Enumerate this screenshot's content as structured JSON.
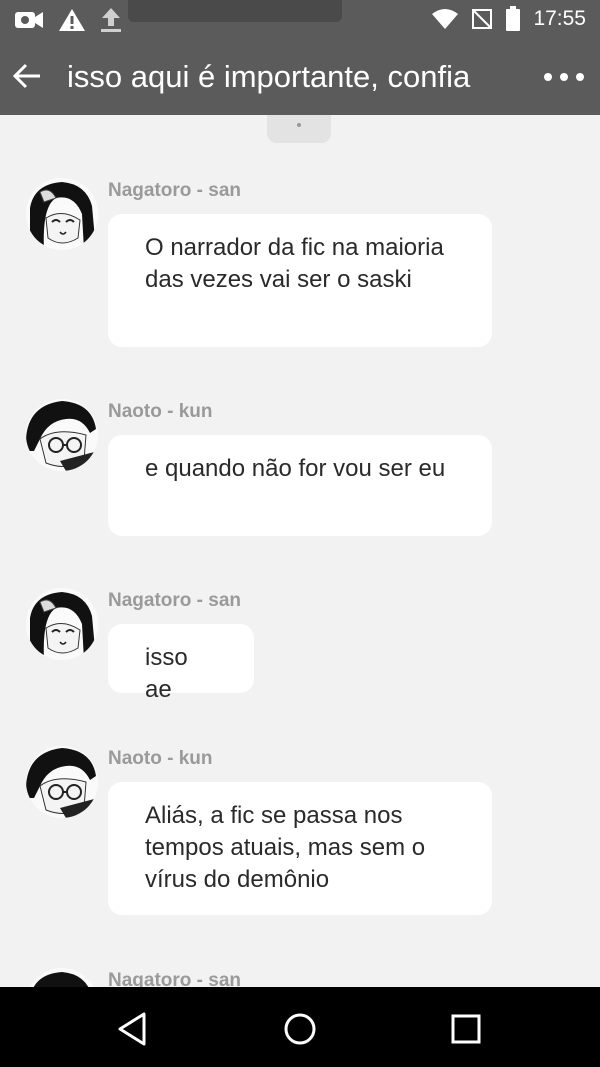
{
  "status_bar": {
    "time": "17:55",
    "left_icons": [
      "video-camera-icon",
      "warning-icon",
      "upload-icon"
    ],
    "right_icons": [
      "wifi-icon",
      "no-sim-icon",
      "battery-icon"
    ]
  },
  "app_bar": {
    "title": "isso aqui é importante, confia",
    "back_icon": "arrow-left-icon",
    "menu_icon": "more-horizontal-icon"
  },
  "messages": [
    {
      "author": "Nagatoro - san",
      "avatar": "avatar-nagatoro",
      "text": "O narrador da fic na maioria das vezes vai ser o saski"
    },
    {
      "author": "Naoto - kun",
      "avatar": "avatar-naoto",
      "text": "e quando não for vou ser eu"
    },
    {
      "author": "Nagatoro - san",
      "avatar": "avatar-nagatoro",
      "text": "isso ae"
    },
    {
      "author": "Naoto - kun",
      "avatar": "avatar-naoto",
      "text": "Aliás, a fic se passa nos tempos atuais, mas sem o vírus do demônio"
    },
    {
      "author": "Nagatoro - san",
      "avatar": "avatar-nagatoro",
      "text": ""
    }
  ],
  "nav_bar": {
    "icons": [
      "back-triangle-icon",
      "home-circle-icon",
      "recents-square-icon"
    ]
  },
  "colors": {
    "app_bar": "#5b5b5b",
    "background": "#f2f2f2",
    "bubble": "#ffffff",
    "author": "#9a9a9a",
    "nav_bar": "#000000"
  }
}
